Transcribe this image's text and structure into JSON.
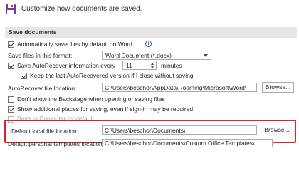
{
  "header": {
    "text": "Customize how documents are saved.",
    "icon": "floppy-disk-icon"
  },
  "section": {
    "title": "Save documents"
  },
  "options": {
    "auto_save_label": "Automatically save files by default on Word",
    "auto_save_checked": true,
    "format_label": "Save files in this format:",
    "format_value": "Word Document (*.docx)",
    "autorecover_label": "Save AutoRecover information every",
    "autorecover_checked": true,
    "autorecover_minutes": "11",
    "minutes_label": "minutes",
    "keep_last_label": "Keep the last AutoRecovered version if I close without saving",
    "keep_last_checked": true,
    "autorecover_location_label": "AutoRecover file location:",
    "autorecover_location_value": "C:\\Users\\beschor\\AppData\\Roaming\\Microsoft\\Word\\",
    "browse_label": "Browse...",
    "backstage_label": "Don't show the Backstage when opening or saving files",
    "backstage_checked": false,
    "additional_places_label": "Show additional places for saving, even if sign-in may be required.",
    "additional_places_checked": true,
    "save_to_computer_label": "Save to Computer by default",
    "save_to_computer_checked": false,
    "default_local_label": "Default local file location:",
    "default_local_value": "C:\\Users\\beschor\\Documents\\",
    "default_templates_label": "Default personal templates location:",
    "default_templates_value": "C:\\Users\\beschor\\Documents\\Custom Office Templates\\"
  },
  "colors": {
    "highlight": "#d9242a",
    "section_bar": "#e6e6e6",
    "accent": "#2b579a"
  }
}
